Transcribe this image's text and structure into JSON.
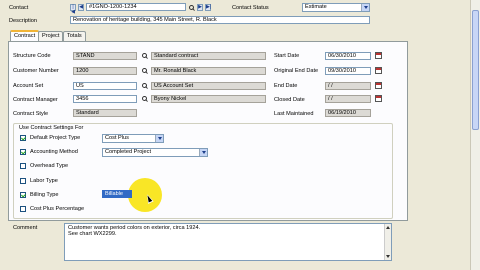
{
  "header": {
    "contact_label": "Contact",
    "contact_value": "#1GNO-1200-1234",
    "contact_status_label": "Contact Status",
    "contact_status_value": "Estimate",
    "description_label": "Description",
    "description_value": "Renovation of heritage building, 345 Main Street, R. Black"
  },
  "tabs": [
    {
      "label": "Contract"
    },
    {
      "label": "Project"
    },
    {
      "label": "Totals"
    }
  ],
  "left_fields": {
    "structure_code": {
      "label": "Structure Code",
      "value": "STAND",
      "desc": "Standard contract"
    },
    "customer_number": {
      "label": "Customer Number",
      "value": "1200",
      "desc": "Mr. Ronald Black"
    },
    "account_set": {
      "label": "Account Set",
      "value": "US",
      "desc": "US Account Set"
    },
    "contract_manager": {
      "label": "Contract Manager",
      "value": "3456",
      "desc": "Byony Nickel"
    },
    "contract_style": {
      "label": "Contract Style",
      "value": "Standard"
    }
  },
  "right_fields": {
    "start_date": {
      "label": "Start Date",
      "value": "06/30/2010"
    },
    "original_end_date": {
      "label": "Original End Date",
      "value": "09/30/2010"
    },
    "end_date": {
      "label": "End Date",
      "value": "/ /"
    },
    "closed_date": {
      "label": "Closed Date",
      "value": "/ /"
    },
    "last_maintained": {
      "label": "Last Maintained",
      "value": "06/19/2010"
    }
  },
  "settings": {
    "group_label": "Use Contract Settings For",
    "default_project_type": {
      "label": "Default Project Type",
      "checked": true,
      "value": "Cost Plus"
    },
    "accounting_method": {
      "label": "Accounting Method",
      "checked": true,
      "value": "Completed Project"
    },
    "overhead_type": {
      "label": "Overhead Type",
      "checked": false
    },
    "labor_type": {
      "label": "Labor Type",
      "checked": false
    },
    "billing_type": {
      "label": "Billing Type",
      "checked": true,
      "value": "Billable"
    },
    "cost_plus_percentage": {
      "label": "Cost Plus Percentage",
      "checked": false
    }
  },
  "comment": {
    "label": "Comment",
    "lines": [
      "Customer wants period colors on exterior, circa 1924.",
      "See chart WX2299."
    ]
  }
}
